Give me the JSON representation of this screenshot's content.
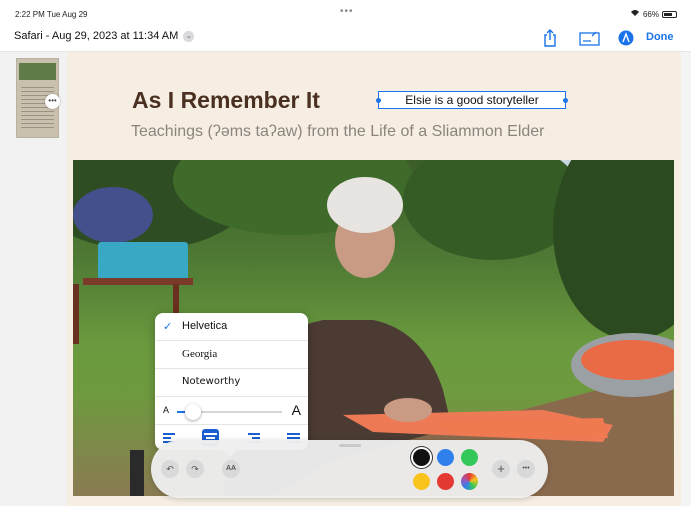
{
  "status_bar": {
    "time": "2:22 PM  Tue Aug 29",
    "battery": "66%",
    "battery_level": 0.66,
    "more": "•••"
  },
  "toolbar": {
    "doc_title": "Safari - Aug 29, 2023 at 11:34 AM",
    "done_label": "Done",
    "icons": [
      "share-icon",
      "signature-icon",
      "markup-icon"
    ],
    "accent_color": "#1a73e8"
  },
  "sidebar": {
    "thumbnail_more": "•••"
  },
  "page": {
    "title": "As I Remember It",
    "subtitle": "Teachings (ʔəms taʔaw) from the Life of a Sliammon Elder"
  },
  "text_annotation": {
    "text": "Elsie is a good storyteller"
  },
  "format_popover": {
    "fonts": [
      {
        "name": "Helvetica",
        "selected": true
      },
      {
        "name": "Georgia",
        "selected": false
      },
      {
        "name": "Noteworthy",
        "selected": false
      }
    ],
    "size_small_label": "A",
    "size_large_label": "A",
    "size_level": 0.15,
    "alignment_options": [
      "left",
      "center",
      "right",
      "justify"
    ],
    "selected_alignment": "center"
  },
  "markup_palette": {
    "undo_icon": "undo-icon",
    "redo_icon": "redo-icon",
    "text_format_label": "AA",
    "colors": [
      "#111111",
      "#2f80ed",
      "#34c759",
      "#f8c31d",
      "#e53935",
      "multicolor"
    ],
    "selected_color": "#111111",
    "add_label": "+",
    "more_label": "•••"
  }
}
